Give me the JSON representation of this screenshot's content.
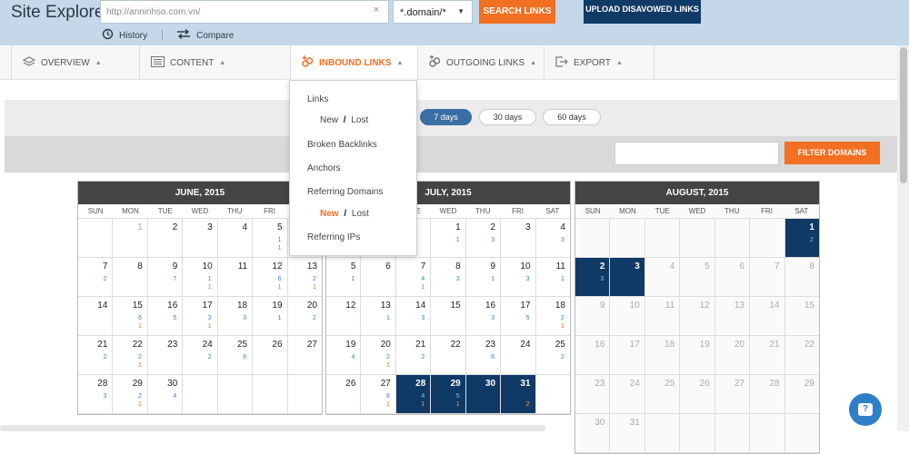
{
  "header": {
    "title": "Site Explorer:",
    "url_value": "http://anninhso.com.vn/",
    "clear_glyph": "×",
    "mode_selected": "*.domain/*",
    "search_label": "SEARCH LINKS",
    "upload_label": "UPLOAD DISAVOWED LINKS",
    "history_label": "History",
    "compare_label": "Compare"
  },
  "nav": {
    "tabs": [
      {
        "label": "OVERVIEW",
        "icon": "layers-icon"
      },
      {
        "label": "CONTENT",
        "icon": "content-icon"
      },
      {
        "label": "INBOUND LINKS",
        "icon": "inbound-links-icon"
      },
      {
        "label": "OUTGOING LINKS",
        "icon": "outgoing-links-icon"
      },
      {
        "label": "EXPORT",
        "icon": "export-icon"
      }
    ]
  },
  "dropdown": {
    "links": "Links",
    "new": "New",
    "slash": "/",
    "lost": "Lost",
    "broken": "Broken Backlinks",
    "anchors": "Anchors",
    "ref_domains": "Referring Domains",
    "ref_ips": "Referring IPs"
  },
  "periods": [
    "7 days",
    "30 days",
    "60 days"
  ],
  "filter": {
    "button_label": "FILTER DOMAINS",
    "value": ""
  },
  "weekdays": [
    "SUN",
    "MON",
    "TUE",
    "WED",
    "THU",
    "FRI",
    "SAT"
  ],
  "calendars": [
    {
      "title": "JUNE, 2015",
      "weeks": [
        [
          {
            "d": ""
          },
          {
            "d": "1",
            "dim": true
          },
          {
            "d": "2"
          },
          {
            "d": "3"
          },
          {
            "d": "4"
          },
          {
            "d": "5",
            "n": "1",
            "l": "1"
          },
          {
            "d": ""
          }
        ],
        [
          {
            "d": "7",
            "n": "2"
          },
          {
            "d": "8"
          },
          {
            "d": "9",
            "n": "7"
          },
          {
            "d": "10",
            "n": "1",
            "l": "1"
          },
          {
            "d": "11"
          },
          {
            "d": "12",
            "n": "6",
            "l": "1"
          },
          {
            "d": "13",
            "n": "2",
            "l": "1"
          }
        ],
        [
          {
            "d": "14"
          },
          {
            "d": "15",
            "n": "6",
            "l": "1"
          },
          {
            "d": "16",
            "n": "5"
          },
          {
            "d": "17",
            "n": "3",
            "l": "1"
          },
          {
            "d": "18",
            "n": "3"
          },
          {
            "d": "19",
            "n": "1"
          },
          {
            "d": "20",
            "n": "2"
          }
        ],
        [
          {
            "d": "21",
            "n": "2"
          },
          {
            "d": "22",
            "n": "2",
            "l": "1"
          },
          {
            "d": "23"
          },
          {
            "d": "24",
            "n": "2"
          },
          {
            "d": "25",
            "n": "6"
          },
          {
            "d": "26"
          },
          {
            "d": "27"
          }
        ],
        [
          {
            "d": "28",
            "n": "3"
          },
          {
            "d": "29",
            "n": "2",
            "l": "1"
          },
          {
            "d": "30",
            "n": "4"
          },
          {
            "d": ""
          },
          {
            "d": ""
          },
          {
            "d": ""
          },
          {
            "d": ""
          }
        ]
      ]
    },
    {
      "title": "JULY, 2015",
      "weeks": [
        [
          {
            "d": ""
          },
          {
            "d": ""
          },
          {
            "d": ""
          },
          {
            "d": "1",
            "n": "1"
          },
          {
            "d": "2",
            "n": "3"
          },
          {
            "d": "3"
          },
          {
            "d": "4",
            "n": "3"
          }
        ],
        [
          {
            "d": "5",
            "n": "1"
          },
          {
            "d": "6"
          },
          {
            "d": "7",
            "n": "4",
            "l": "1"
          },
          {
            "d": "8",
            "n": "3"
          },
          {
            "d": "9",
            "n": "1"
          },
          {
            "d": "10",
            "n": "3"
          },
          {
            "d": "11",
            "n": "1"
          }
        ],
        [
          {
            "d": "12"
          },
          {
            "d": "13",
            "n": "1"
          },
          {
            "d": "14",
            "n": "3"
          },
          {
            "d": "15"
          },
          {
            "d": "16",
            "n": "3"
          },
          {
            "d": "17",
            "n": "5"
          },
          {
            "d": "18",
            "n": "2",
            "l": "1"
          }
        ],
        [
          {
            "d": "19",
            "n": "4"
          },
          {
            "d": "20",
            "n": "2",
            "l": "1"
          },
          {
            "d": "21",
            "n": "2"
          },
          {
            "d": "22"
          },
          {
            "d": "23",
            "n": "6"
          },
          {
            "d": "24"
          },
          {
            "d": "25",
            "n": "2"
          }
        ],
        [
          {
            "d": "26"
          },
          {
            "d": "27",
            "n": "8",
            "l": "1"
          },
          {
            "d": "28",
            "n": "4",
            "l": "1",
            "hl": true
          },
          {
            "d": "29",
            "n": "5",
            "l": "1",
            "hl": true
          },
          {
            "d": "30",
            "hl": true
          },
          {
            "d": "31",
            "l": "2",
            "hl": true
          },
          {
            "d": ""
          }
        ]
      ]
    },
    {
      "title": "AUGUST, 2015",
      "weeks": [
        [
          {
            "d": ""
          },
          {
            "d": ""
          },
          {
            "d": ""
          },
          {
            "d": ""
          },
          {
            "d": ""
          },
          {
            "d": ""
          },
          {
            "d": "1",
            "n": "2",
            "hl": true
          }
        ],
        [
          {
            "d": "2",
            "n": "3",
            "hl": true
          },
          {
            "d": "3",
            "hl": true
          },
          {
            "d": "4",
            "dim": true
          },
          {
            "d": "5",
            "dim": true
          },
          {
            "d": "6",
            "dim": true
          },
          {
            "d": "7",
            "dim": true
          },
          {
            "d": "8",
            "dim": true
          }
        ],
        [
          {
            "d": "9",
            "dim": true
          },
          {
            "d": "10",
            "dim": true
          },
          {
            "d": "11",
            "dim": true
          },
          {
            "d": "12",
            "dim": true
          },
          {
            "d": "13",
            "dim": true
          },
          {
            "d": "14",
            "dim": true
          },
          {
            "d": "15",
            "dim": true
          }
        ],
        [
          {
            "d": "16",
            "dim": true
          },
          {
            "d": "17",
            "dim": true
          },
          {
            "d": "18",
            "dim": true
          },
          {
            "d": "19",
            "dim": true
          },
          {
            "d": "20",
            "dim": true
          },
          {
            "d": "21",
            "dim": true
          },
          {
            "d": "22",
            "dim": true
          }
        ],
        [
          {
            "d": "23",
            "dim": true
          },
          {
            "d": "24",
            "dim": true
          },
          {
            "d": "25",
            "dim": true
          },
          {
            "d": "26",
            "dim": true
          },
          {
            "d": "27",
            "dim": true
          },
          {
            "d": "28",
            "dim": true
          },
          {
            "d": "29",
            "dim": true
          }
        ],
        [
          {
            "d": "30",
            "dim": true
          },
          {
            "d": "31",
            "dim": true
          },
          {
            "d": ""
          },
          {
            "d": ""
          },
          {
            "d": ""
          },
          {
            "d": ""
          },
          {
            "d": ""
          }
        ]
      ]
    }
  ],
  "chat": {
    "glyph": "?"
  },
  "colors": {
    "accent": "#f36f21",
    "navy": "#0f3a66",
    "header_bg": "#c4d8ea",
    "new_blue": "#3f7fc2"
  }
}
